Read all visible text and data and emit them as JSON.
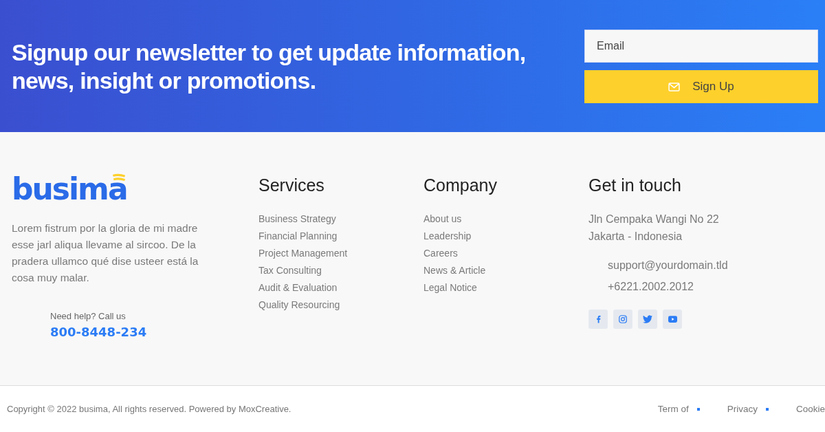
{
  "newsletter": {
    "heading": "Signup our newsletter to get update information, news, insight or promotions.",
    "email_placeholder": "Email",
    "button": "Sign Up"
  },
  "brand": {
    "logo": "busima",
    "description": "Lorem fistrum por la gloria de mi madre esse jarl aliqua llevame al sircoo. De la pradera ullamco qué dise usteer está la cosa muy malar.",
    "help_label": "Need help? Call us",
    "help_phone": "800-8448-234"
  },
  "services": {
    "title": "Services",
    "links": [
      "Business Strategy",
      "Financial Planning",
      "Project Management",
      "Tax Consulting",
      "Audit & Evaluation",
      "Quality Resourcing"
    ]
  },
  "company": {
    "title": "Company",
    "links": [
      "About us",
      "Leadership",
      "Careers",
      "News & Article",
      "Legal Notice"
    ]
  },
  "contact": {
    "title": "Get in touch",
    "address": [
      "Jln Cempaka Wangi No 22",
      "Jakarta - Indonesia"
    ],
    "email": "support@yourdomain.tld",
    "phone": "+6221.2002.2012",
    "socials": [
      {
        "kind": "facebook"
      },
      {
        "kind": "instagram"
      },
      {
        "kind": "twitter"
      },
      {
        "kind": "youtube"
      }
    ]
  },
  "bottom": {
    "copyright": "Copyright © 2022 busima, All rights reserved. Powered by MoxCreative.",
    "links": [
      "Term of",
      "Privacy",
      "Cookie"
    ]
  }
}
